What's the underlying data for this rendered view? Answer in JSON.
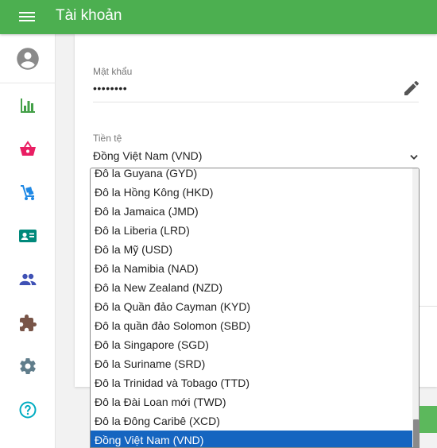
{
  "app": {
    "title": "Tài khoản"
  },
  "colors": {
    "primary": "#4caf50",
    "selected": "#1565c0"
  },
  "sidebar": {
    "items": [
      {
        "icon": "account-circle-icon"
      },
      {
        "icon": "bar-chart-icon",
        "color": "#43a047"
      },
      {
        "icon": "shopping-basket-icon",
        "color": "#e91e63"
      },
      {
        "icon": "dolly-cart-icon",
        "color": "#1e88e5"
      },
      {
        "icon": "contact-card-icon",
        "color": "#00897b"
      },
      {
        "icon": "people-icon",
        "color": "#3f51b5"
      },
      {
        "icon": "puzzle-icon",
        "color": "#795548"
      },
      {
        "icon": "gear-icon",
        "color": "#607d8b"
      },
      {
        "icon": "help-icon",
        "color": "#00acc1"
      }
    ]
  },
  "account": {
    "password_label": "Mật khẩu",
    "password_value": "••••••••",
    "currency_label": "Tiền tệ",
    "currency_value": "Đồng Việt Nam (VND)"
  },
  "currency_dropdown": {
    "options": [
      "Đô la Guyana (GYD)",
      "Đô la Hồng Kông (HKD)",
      "Đô la Jamaica (JMD)",
      "Đô la Liberia (LRD)",
      "Đô la Mỹ (USD)",
      "Đô la Namibia (NAD)",
      "Đô la New Zealand (NZD)",
      "Đô la Quần đảo Cayman (KYD)",
      "Đô la quần đảo Solomon (SBD)",
      "Đô la Singapore (SGD)",
      "Đô la Suriname (SRD)",
      "Đô la Trinidad và Tobago (TTD)",
      "Đô la Đài Loan mới (TWD)",
      "Đô la Đông Caribê (XCD)",
      "Đồng Việt Nam (VND)"
    ],
    "selected": "Đồng Việt Nam (VND)"
  }
}
